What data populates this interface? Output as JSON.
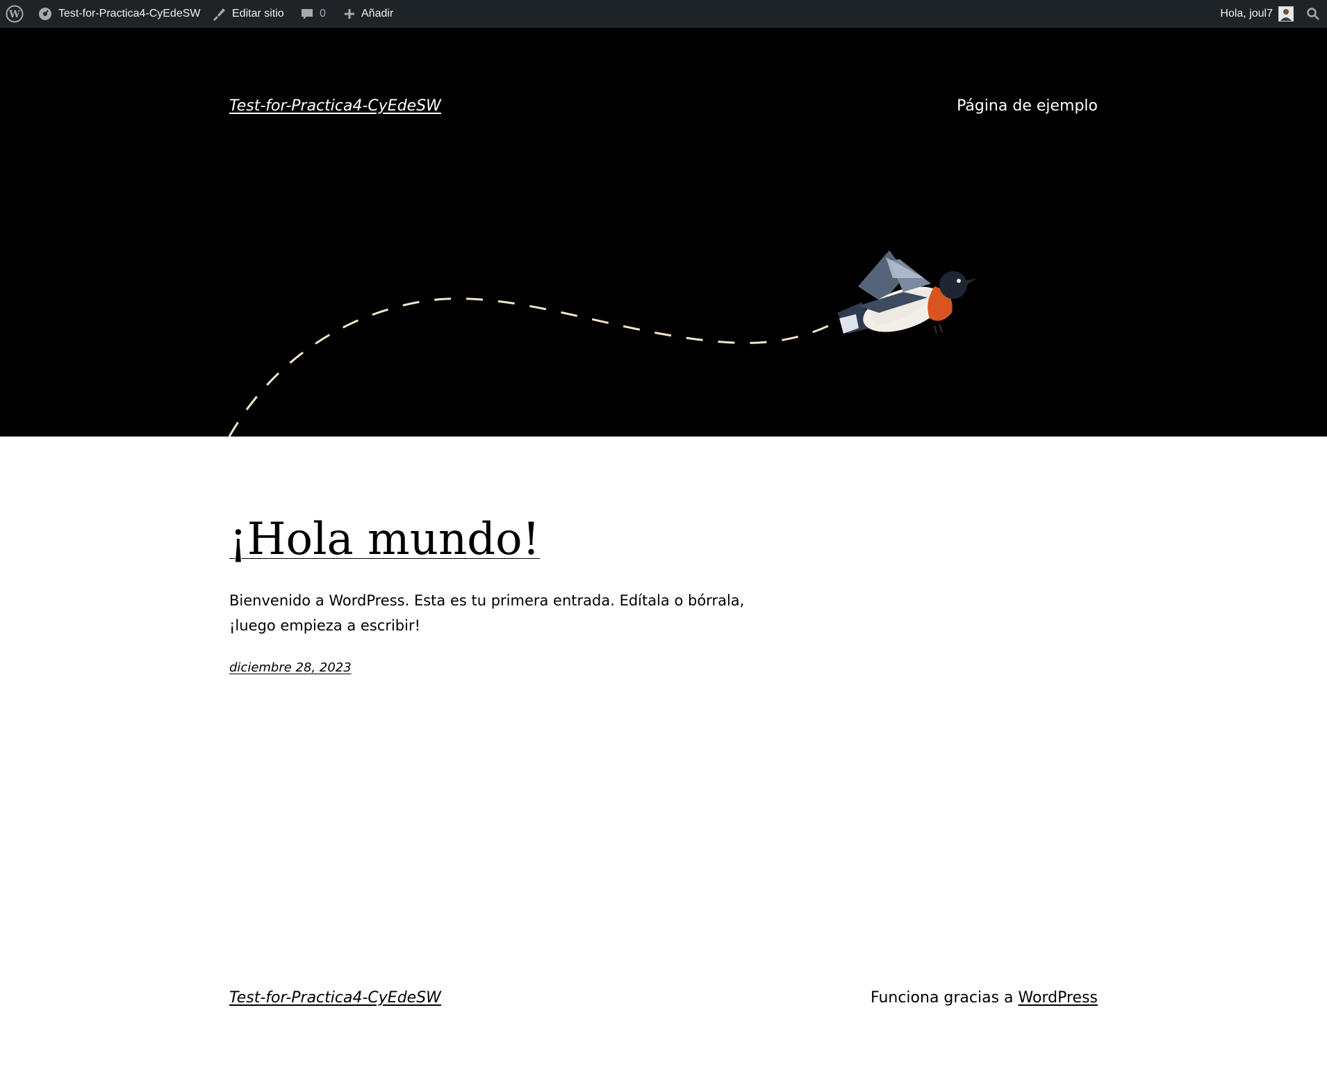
{
  "admin_bar": {
    "site_name": "Test-for-Practica4-CyEdeSW",
    "edit_site": "Editar sitio",
    "comments_count": "0",
    "add_new": "Añadir",
    "greeting": "Hola, joul7"
  },
  "header": {
    "site_title": "Test-for-Practica4-CyEdeSW",
    "nav_item": "Página de ejemplo"
  },
  "post": {
    "title": "¡Hola mundo!",
    "excerpt": "Bienvenido a WordPress. Esta es tu primera entrada. Edítala o bórrala, ¡luego empieza a escribir!",
    "date": "diciembre 28, 2023"
  },
  "footer": {
    "site_title": "Test-for-Practica4-CyEdeSW",
    "credit_prefix": "Funciona gracias a ",
    "credit_link": "WordPress"
  },
  "colors": {
    "admin_bar_bg": "#1d2327",
    "hero_bg": "#000000",
    "page_bg": "#ffffff",
    "dashed_path": "#f3e6c9"
  }
}
